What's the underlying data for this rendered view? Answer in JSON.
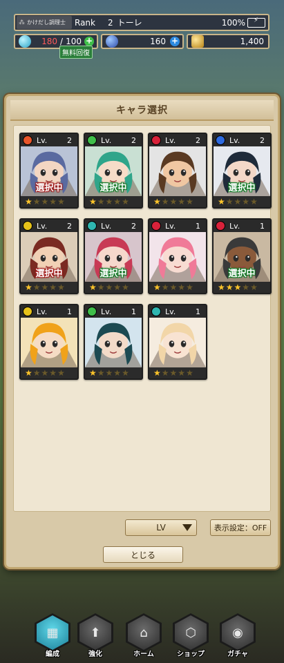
{
  "status": {
    "title_badge": "かけだし調理士",
    "rank_label": "Rank",
    "rank_value": "2",
    "player_name": "トーレ",
    "battery": "100%"
  },
  "resources": {
    "stamina_current": "180",
    "stamina_max": "100",
    "free_recovery": "無料回復",
    "gems": "160",
    "gold": "1,400"
  },
  "modal": {
    "title": "キャラ選択",
    "sort_label": "LV",
    "display_setting": "表示設定：OFF",
    "close_label": "とじる"
  },
  "characters": [
    {
      "lv_label": "Lv.",
      "level": "2",
      "element": "fire",
      "element_color": "#e8552a",
      "stars": 1,
      "badge": "選択中",
      "badge_color": "red",
      "hair": "#5a6aa0",
      "skin": "#f3d6c2",
      "bg": "#b9c3d6"
    },
    {
      "lv_label": "Lv.",
      "level": "2",
      "element": "wind",
      "element_color": "#3fbf4a",
      "stars": 1,
      "badge": "選択中",
      "badge_color": "green",
      "hair": "#2fa58a",
      "skin": "#f6dcc8",
      "bg": "#c9e0d3"
    },
    {
      "lv_label": "Lv.",
      "level": "2",
      "element": "fire",
      "element_color": "#d8223a",
      "stars": 1,
      "badge": "",
      "badge_color": "",
      "hair": "#5a3a22",
      "skin": "#f0c7a2",
      "bg": "#e4e4e4"
    },
    {
      "lv_label": "Lv.",
      "level": "2",
      "element": "water",
      "element_color": "#2e6be0",
      "stars": 1,
      "badge": "選択中",
      "badge_color": "green",
      "hair": "#1f2b3a",
      "skin": "#f4d8c8",
      "bg": "#e6e9ef"
    },
    {
      "lv_label": "Lv.",
      "level": "2",
      "element": "light",
      "element_color": "#e6c21a",
      "stars": 1,
      "badge": "選択中",
      "badge_color": "red",
      "hair": "#7a2a22",
      "skin": "#f1d0b5",
      "bg": "#dccdb8"
    },
    {
      "lv_label": "Lv.",
      "level": "2",
      "element": "aqua",
      "element_color": "#2fb6b0",
      "stars": 1,
      "badge": "選択中",
      "badge_color": "green",
      "hair": "#c83a55",
      "skin": "#f6d8cc",
      "bg": "#d7c5cc"
    },
    {
      "lv_label": "Lv.",
      "level": "1",
      "element": "fire",
      "element_color": "#d8223a",
      "stars": 1,
      "badge": "",
      "badge_color": "",
      "hair": "#f07a98",
      "skin": "#f8dcd2",
      "bg": "#f2e4ea"
    },
    {
      "lv_label": "Lv.",
      "level": "1",
      "element": "fire",
      "element_color": "#d8223a",
      "stars": 3,
      "badge": "選択中",
      "badge_color": "green",
      "hair": "#3a3a3a",
      "skin": "#8a5a3a",
      "bg": "#c9b9a2"
    },
    {
      "lv_label": "Lv.",
      "level": "1",
      "element": "light",
      "element_color": "#e6c21a",
      "stars": 1,
      "badge": "",
      "badge_color": "",
      "hair": "#f0a21a",
      "skin": "#f6dcc4",
      "bg": "#f3e2b8"
    },
    {
      "lv_label": "Lv.",
      "level": "1",
      "element": "wind",
      "element_color": "#3fbf4a",
      "stars": 1,
      "badge": "",
      "badge_color": "",
      "hair": "#1c4a52",
      "skin": "#f3dbc9",
      "bg": "#d3e4ee"
    },
    {
      "lv_label": "Lv.",
      "level": "1",
      "element": "aqua",
      "element_color": "#2fb6b0",
      "stars": 1,
      "badge": "",
      "badge_color": "",
      "hair": "#f2d6a8",
      "skin": "#f8e3d2",
      "bg": "#f5ecdf"
    }
  ],
  "nav": [
    {
      "label": "編成",
      "icon": "cards-icon",
      "glyph": "▦",
      "active": true
    },
    {
      "label": "強化",
      "icon": "upgrade-icon",
      "glyph": "⬆",
      "active": false
    },
    {
      "label": "ホーム",
      "icon": "home-icon",
      "glyph": "⌂",
      "active": false
    },
    {
      "label": "ショップ",
      "icon": "shop-icon",
      "glyph": "⬡",
      "active": false
    },
    {
      "label": "ガチャ",
      "icon": "gacha-icon",
      "glyph": "◉",
      "active": false
    }
  ]
}
